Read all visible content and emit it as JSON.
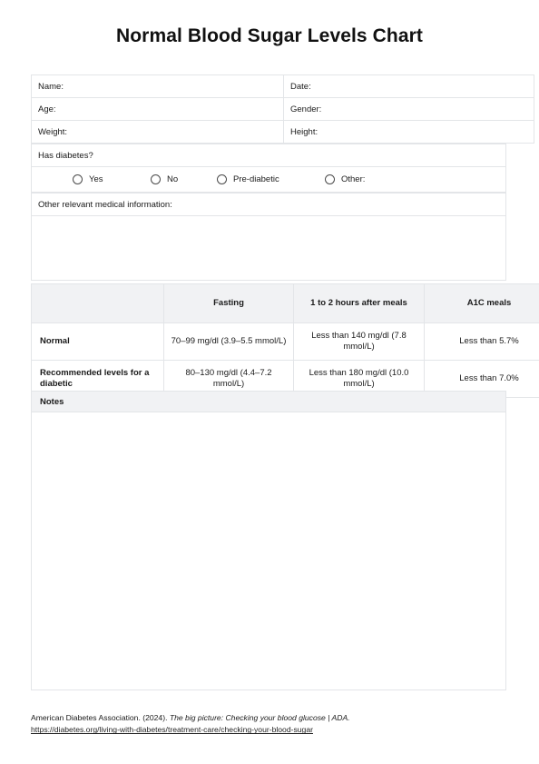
{
  "document": {
    "title": "Normal Blood Sugar Levels Chart"
  },
  "patient_info": {
    "rows": [
      {
        "left": "Name:",
        "right": "Date:"
      },
      {
        "left": "Age:",
        "right": "Gender:"
      },
      {
        "left": "Weight:",
        "right": "Height:"
      }
    ]
  },
  "diabetes_question": {
    "label": "Has diabetes?",
    "options": [
      {
        "label": "Yes"
      },
      {
        "label": "No"
      },
      {
        "label": "Pre-diabetic"
      },
      {
        "label": "Other:"
      }
    ]
  },
  "medical_info": {
    "label": "Other relevant medical information:",
    "value": ""
  },
  "levels_table": {
    "headers": [
      "",
      "Fasting",
      "1 to 2 hours after meals",
      "A1C meals"
    ],
    "rows": [
      {
        "label": "Normal",
        "fasting": "70–99 mg/dl (3.9–5.5 mmol/L)",
        "after_meals": "Less than 140 mg/dl (7.8 mmol/L)",
        "a1c": "Less than 5.7%"
      },
      {
        "label": "Recommended levels for a diabetic",
        "fasting": "80–130 mg/dl (4.4–7.2 mmol/L)",
        "after_meals": "Less than 180 mg/dl (10.0 mmol/L)",
        "a1c": "Less than 7.0%"
      }
    ]
  },
  "notes": {
    "header": "Notes",
    "value": ""
  },
  "footer": {
    "citation_prefix": "American Diabetes Association. (2024). ",
    "citation_italic": "The big picture: Checking your blood glucose | ADA.",
    "citation_url": "https://diabetes.org/living-with-diabetes/treatment-care/checking-your-blood-sugar"
  },
  "colors": {
    "header_gray": "#f1f2f4",
    "border": "#e3e5e8",
    "text": "#1a1a1a"
  }
}
